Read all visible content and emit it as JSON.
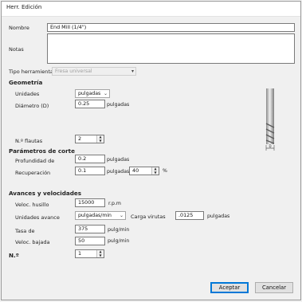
{
  "dialog": {
    "title": "Herr. Edición"
  },
  "name": {
    "label": "Nombre",
    "value": "End Mill (1/4\")"
  },
  "notes": {
    "label": "Notas",
    "value": ""
  },
  "tool_type": {
    "label": "Tipo herramienta",
    "value": "Fresa universal"
  },
  "geometry": {
    "heading": "Geometría",
    "units_label": "Unidades",
    "units_value": "pulgadas",
    "diameter_label": "Diámetro (D)",
    "diameter_value": "0.25",
    "diameter_unit": "pulgadas",
    "flutes_label": "N.º flautas",
    "flutes_value": "2",
    "diagram_label": "D"
  },
  "cutting": {
    "heading": "Parámetros de corte",
    "depth_label": "Profundidad de",
    "depth_value": "0.2",
    "depth_unit": "pulgadas",
    "stepover_label": "Recuperación",
    "stepover_value": "0.1",
    "stepover_unit": "pulgadas",
    "stepover_pct": "40",
    "pct_symbol": "%"
  },
  "feeds": {
    "heading": "Avances y velocidades",
    "spindle_label": "Veloc. husillo",
    "spindle_value": "15000",
    "spindle_unit": "r.p.m",
    "feed_units_label": "Unidades avance",
    "feed_units_value": "pulgadas/min",
    "chip_load_label": "Carga virutas",
    "chip_load_value": ".0125",
    "chip_load_unit": "pulgadas",
    "feed_rate_label": "Tasa de",
    "feed_rate_value": "375",
    "feed_rate_unit": "pulg/min",
    "plunge_label": "Veloc. bajada",
    "plunge_value": "50",
    "plunge_unit": "pulg/min"
  },
  "tool_number": {
    "label": "N.º",
    "value": "1"
  },
  "buttons": {
    "accept": "Aceptar",
    "cancel": "Cancelar"
  }
}
